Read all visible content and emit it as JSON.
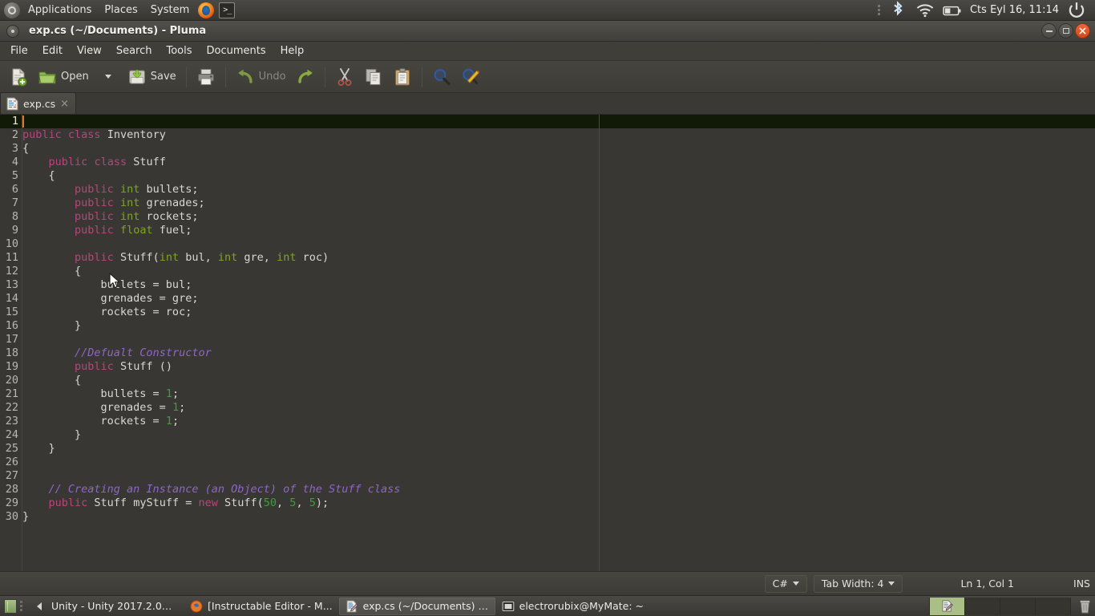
{
  "desktop": {
    "panel": {
      "logo_icon": "ubuntu-logo-icon",
      "menus": [
        "Applications",
        "Places",
        "System"
      ],
      "launchers": [
        {
          "name": "firefox-icon",
          "title": "Firefox"
        },
        {
          "name": "terminal-icon",
          "title": "Terminal",
          "glyph": ">_"
        }
      ],
      "indicators": [
        "dots-icon",
        "bluetooth-icon",
        "wifi-icon",
        "battery-icon"
      ],
      "clock": "Cts Eyl 16, 11:14",
      "power_icon": "power-icon"
    },
    "taskbar": {
      "show_desktop_icon": "show-desktop-icon",
      "tasks": [
        {
          "label": "Unity - Unity 2017.2.0b...",
          "icon": "unity-icon",
          "active": false
        },
        {
          "label": "[Instructable Editor - M...",
          "icon": "firefox-icon",
          "active": false
        },
        {
          "label": "exp.cs (~/Documents) -...",
          "icon": "pluma-icon",
          "active": true
        },
        {
          "label": "electrorubix@MyMate: ~",
          "icon": "terminal-icon",
          "active": false
        }
      ],
      "workspaces": [
        {
          "index": 1,
          "active": true
        },
        {
          "index": 2,
          "active": false
        },
        {
          "index": 3,
          "active": false
        },
        {
          "index": 4,
          "active": false
        }
      ],
      "trash_icon": "trash-icon"
    }
  },
  "window": {
    "title": "exp.cs (~/Documents) - Pluma",
    "menu_button_icon": "window-menu-icon",
    "buttons": [
      {
        "name": "minimize-button",
        "icon": "minimize-icon"
      },
      {
        "name": "maximize-button",
        "icon": "maximize-icon"
      },
      {
        "name": "close-button",
        "icon": "close-icon"
      }
    ],
    "menubar": [
      "File",
      "Edit",
      "View",
      "Search",
      "Tools",
      "Documents",
      "Help"
    ],
    "toolbar": [
      {
        "name": "new-button",
        "icon": "new-document-icon",
        "label": ""
      },
      {
        "name": "open-button",
        "icon": "open-folder-icon",
        "label": "Open"
      },
      {
        "name": "open-dropdown-button",
        "icon": "chevron-down-icon",
        "label": ""
      },
      {
        "name": "save-button",
        "icon": "save-icon",
        "label": "Save"
      },
      {
        "name": "print-button",
        "icon": "print-icon",
        "label": ""
      },
      {
        "name": "undo-button",
        "icon": "undo-icon",
        "label": "Undo"
      },
      {
        "name": "redo-button",
        "icon": "redo-icon",
        "label": ""
      },
      {
        "name": "cut-button",
        "icon": "cut-icon",
        "label": ""
      },
      {
        "name": "copy-button",
        "icon": "copy-icon",
        "label": ""
      },
      {
        "name": "paste-button",
        "icon": "paste-icon",
        "label": ""
      },
      {
        "name": "find-button",
        "icon": "find-icon",
        "label": ""
      },
      {
        "name": "replace-button",
        "icon": "replace-icon",
        "label": ""
      }
    ],
    "tabs": [
      {
        "label": "exp.cs",
        "icon": "document-icon",
        "close_glyph": "×",
        "active": true
      }
    ]
  },
  "editor": {
    "cursor_line": 1,
    "line_numbers": [
      1,
      2,
      3,
      4,
      5,
      6,
      7,
      8,
      9,
      10,
      11,
      12,
      13,
      14,
      15,
      16,
      17,
      18,
      19,
      20,
      21,
      22,
      23,
      24,
      25,
      26,
      27,
      28,
      29,
      30
    ],
    "lines": [
      {
        "n": 1,
        "text": ""
      },
      {
        "n": 2,
        "text": "public class Inventory"
      },
      {
        "n": 3,
        "text": "{"
      },
      {
        "n": 4,
        "text": "    public class Stuff"
      },
      {
        "n": 5,
        "text": "    {"
      },
      {
        "n": 6,
        "text": "        public int bullets;"
      },
      {
        "n": 7,
        "text": "        public int grenades;"
      },
      {
        "n": 8,
        "text": "        public int rockets;"
      },
      {
        "n": 9,
        "text": "        public float fuel;"
      },
      {
        "n": 10,
        "text": ""
      },
      {
        "n": 11,
        "text": "        public Stuff(int bul, int gre, int roc)"
      },
      {
        "n": 12,
        "text": "        {"
      },
      {
        "n": 13,
        "text": "            bullets = bul;"
      },
      {
        "n": 14,
        "text": "            grenades = gre;"
      },
      {
        "n": 15,
        "text": "            rockets = roc;"
      },
      {
        "n": 16,
        "text": "        }"
      },
      {
        "n": 17,
        "text": ""
      },
      {
        "n": 18,
        "text": "        //Defualt Constructor"
      },
      {
        "n": 19,
        "text": "        public Stuff ()"
      },
      {
        "n": 20,
        "text": "        {"
      },
      {
        "n": 21,
        "text": "            bullets = 1;"
      },
      {
        "n": 22,
        "text": "            grenades = 1;"
      },
      {
        "n": 23,
        "text": "            rockets = 1;"
      },
      {
        "n": 24,
        "text": "        }"
      },
      {
        "n": 25,
        "text": "    }"
      },
      {
        "n": 26,
        "text": ""
      },
      {
        "n": 27,
        "text": ""
      },
      {
        "n": 28,
        "text": "    // Creating an Instance (an Object) of the Stuff class"
      },
      {
        "n": 29,
        "text": "    public Stuff myStuff = new Stuff(50, 5, 5);"
      },
      {
        "n": 30,
        "text": "}"
      }
    ],
    "highlight_colors": {
      "keyword": "#b9447b",
      "type": "#7da42a",
      "number": "#3c9e3c",
      "comment": "#8f66c8",
      "text": "#d9d7d1",
      "background": "#383734",
      "current_line": "#111a06",
      "caret": "#e4762a"
    }
  },
  "statusbar": {
    "language": "C#",
    "tab_width_label": "Tab Width: 4",
    "position": "Ln 1, Col 1",
    "insert_mode": "INS"
  }
}
